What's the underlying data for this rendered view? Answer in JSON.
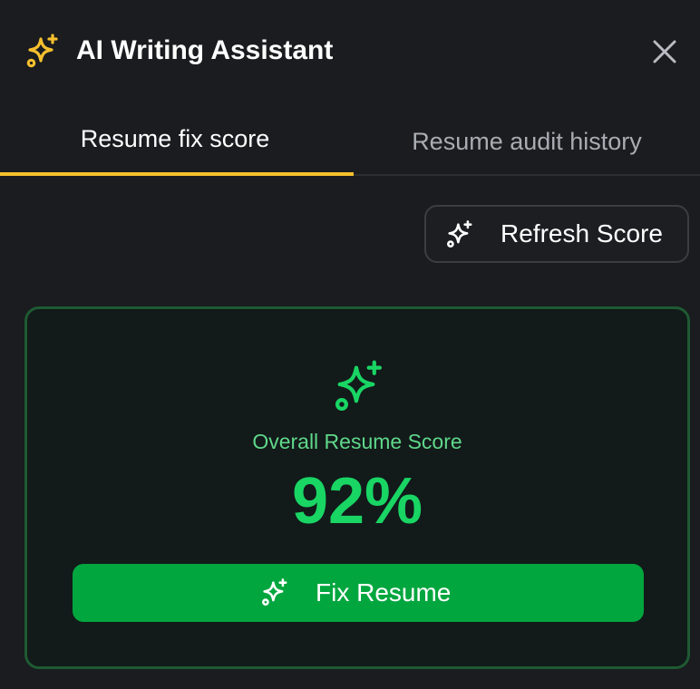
{
  "header": {
    "title": "AI Writing Assistant",
    "icon": "sparkles-icon",
    "accent_color": "#f5c02e",
    "close_icon": "close-icon"
  },
  "tabs": [
    {
      "label": "Resume fix score",
      "active": true
    },
    {
      "label": "Resume audit history",
      "active": false
    }
  ],
  "toolbar": {
    "refresh_label": "Refresh Score",
    "refresh_icon": "sparkles-icon"
  },
  "score_card": {
    "label": "Overall Resume Score",
    "value": "92%",
    "score_color": "#19d564",
    "border_color": "#1e5a32",
    "icon": "sparkles-icon",
    "fix_button_label": "Fix Resume",
    "fix_button_color": "#02a63e"
  }
}
